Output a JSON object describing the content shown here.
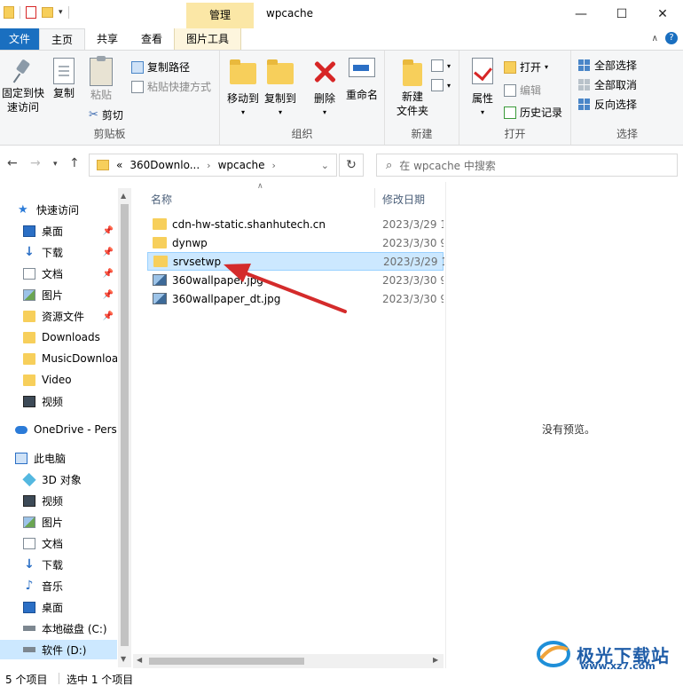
{
  "window": {
    "title": "wpcache",
    "context_tab_title": "管理",
    "controls": {
      "minimize": "—",
      "maximize": "☐",
      "close": "✕"
    }
  },
  "tabs": [
    {
      "label": "文件"
    },
    {
      "label": "主页"
    },
    {
      "label": "共享"
    },
    {
      "label": "查看"
    },
    {
      "label": "图片工具"
    }
  ],
  "ribbon": {
    "clipboard": {
      "label": "剪贴板",
      "pin": "固定到快速访问",
      "pin_l1": "固定到快",
      "pin_l2": "速访问",
      "copy": "复制",
      "paste": "粘贴",
      "copy_path": "复制路径",
      "paste_shortcut": "粘贴快捷方式",
      "cut": "剪切"
    },
    "organize": {
      "label": "组织",
      "move_to": "移动到",
      "copy_to": "复制到",
      "delete": "删除",
      "rename": "重命名"
    },
    "new": {
      "label": "新建",
      "new_folder_l1": "新建",
      "new_folder_l2": "文件夹"
    },
    "open": {
      "label": "打开",
      "properties": "属性",
      "open": "打开",
      "edit": "编辑",
      "history": "历史记录"
    },
    "select": {
      "label": "选择",
      "select_all": "全部选择",
      "select_none": "全部取消",
      "invert": "反向选择"
    }
  },
  "address": {
    "overflow": "«",
    "crumbs": [
      "360Downlo...",
      "wpcache"
    ],
    "search_placeholder": "在 wpcache 中搜索"
  },
  "nav": {
    "quick_access": "快速访问",
    "items": [
      {
        "label": "桌面"
      },
      {
        "label": "下载"
      },
      {
        "label": "文档"
      },
      {
        "label": "图片"
      },
      {
        "label": "资源文件"
      },
      {
        "label": "Downloads"
      },
      {
        "label": "MusicDownload"
      },
      {
        "label": "Video"
      },
      {
        "label": "视频"
      }
    ],
    "onedrive": "OneDrive - Personal",
    "this_pc": "此电脑",
    "pc_items": [
      {
        "label": "3D 对象"
      },
      {
        "label": "视频"
      },
      {
        "label": "图片"
      },
      {
        "label": "文档"
      },
      {
        "label": "下载"
      },
      {
        "label": "音乐"
      },
      {
        "label": "桌面"
      },
      {
        "label": "本地磁盘 (C:)"
      },
      {
        "label": "软件 (D:)"
      }
    ]
  },
  "list": {
    "headers": {
      "name": "名称",
      "date": "修改日期"
    },
    "rows": [
      {
        "name": "cdn-hw-static.shanhutech.cn",
        "date": "2023/3/29 1"
      },
      {
        "name": "dynwp",
        "date": "2023/3/30 9"
      },
      {
        "name": "srvsetwp",
        "date": "2023/3/29 1"
      },
      {
        "name": "360wallpaper.jpg",
        "date": "2023/3/30 9"
      },
      {
        "name": "360wallpaper_dt.jpg",
        "date": "2023/3/30 9"
      }
    ]
  },
  "preview": {
    "text": "没有预览。"
  },
  "status": {
    "count": "5 个项目",
    "selected": "选中 1 个项目"
  },
  "watermark": {
    "text": "极光下载站",
    "url": "www.xz7.com"
  },
  "colors": {
    "accent": "#1a6fc0",
    "selection": "#cce8ff",
    "context_tab": "#fbe7a6",
    "arrow": "#d42b2b"
  }
}
